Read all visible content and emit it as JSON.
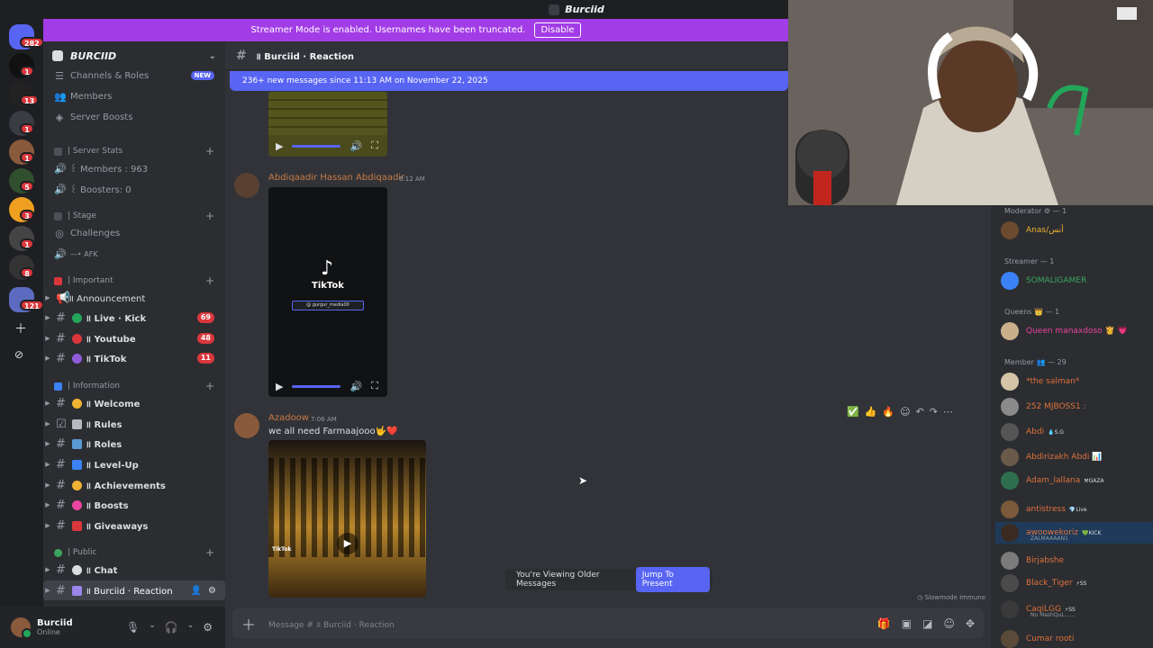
{
  "title": "Burciid",
  "streamer_banner": {
    "text": "Streamer Mode is enabled. Usernames have been truncated.",
    "button": "Disable"
  },
  "rail": {
    "badges": [
      "282",
      "1",
      "13",
      "1",
      "1",
      "5",
      "3",
      "1",
      "8",
      "1",
      "121"
    ]
  },
  "sidebar": {
    "server_name": "BURCIID",
    "top_items": [
      {
        "label": "Channels & Roles",
        "icon": "list-icon",
        "badge": "NEW"
      },
      {
        "label": "Members",
        "icon": "members-icon"
      },
      {
        "label": "Server Boosts",
        "icon": "boost-icon"
      }
    ],
    "cat_stats": "| Server Stats",
    "stat_members": "꒰ Members : 963",
    "stat_boosters": "꒰ Boosters: 0",
    "cat_stage": "| Stage",
    "challenges": "Challenges",
    "afk": "—‣ AFK",
    "cat_important": "| Important",
    "announcement": "॥ Announcement",
    "live_kick": "॥ Live · Kick",
    "live_kick_count": "69",
    "youtube": "॥ Youtube",
    "youtube_count": "48",
    "tiktok": "॥ TikTok",
    "tiktok_count": "11",
    "cat_info": "| Information",
    "welcome": "॥ Welcome",
    "rules1": "॥ Rules",
    "rules2": "॥ Roles",
    "levelup": "॥ Level-Up",
    "achievements": "॥ Achievements",
    "boosts": "॥ Boosts",
    "giveaways": "॥ Giveaways",
    "cat_public": "| Public",
    "chat": "॥ Chat",
    "reaction": "॥ Burciid · Reaction"
  },
  "user": {
    "name": "Burciid",
    "status": "Online"
  },
  "chat": {
    "channel": "॥ Burciid · Reaction",
    "new_messages": "236+ new messages since 11:13 AM on November 22, 2025",
    "msg1": {
      "author": "Abdiqaadir Hassan Abdiqaadir",
      "time": "6:12 AM",
      "tiktok_label": "TikTok",
      "tiktok_handle": "@ gurgur_media00"
    },
    "msg2": {
      "author": "Azadoow",
      "time": "7:06 AM",
      "text": "we all need Farmaajooo🤟❤️",
      "video_label": "TikTok"
    },
    "older_text": "You're Viewing Older Messages",
    "jump_button": "Jump To Present",
    "slowmode": "Slowmode Immune",
    "composer_placeholder": "Message # ॥ Burciid · Reaction"
  },
  "members": {
    "roles": [
      {
        "label": "Moderator ⚙ — 1"
      },
      {
        "label": "Streamer — 1"
      },
      {
        "label": "Queens 👑 — 1"
      },
      {
        "label": "Member 👥 — 29"
      }
    ],
    "list": [
      {
        "name": "Anas/أنس",
        "color": "#f0b232"
      },
      {
        "name": "SOMALIGAMER",
        "color": "#3ba55d"
      },
      {
        "name": "Queen manaxdoso 👸 💗",
        "color": "#eb459f"
      },
      {
        "name": "*the salman*",
        "color": "#e0713b"
      },
      {
        "name": "252 MJBOSS1 :",
        "color": "#e0713b"
      },
      {
        "name": "Abdi",
        "color": "#e0713b",
        "tag": "💧S.G"
      },
      {
        "name": "Abdirizakh Abdi 📊",
        "color": "#e0713b"
      },
      {
        "name": "Adam_lallana",
        "color": "#e0713b",
        "tag": "⚒GAZA"
      },
      {
        "name": "antistress",
        "color": "#e0713b",
        "tag": "💎Live"
      },
      {
        "name": "awoowekoriz",
        "color": "#e0713b",
        "tag": "💚KICK",
        "sub": "ZALMAAAAN1"
      },
      {
        "name": "Birjabshe",
        "color": "#e0713b"
      },
      {
        "name": "Black_Tiger",
        "color": "#e0713b",
        "tag": "⚡SS"
      },
      {
        "name": "CaqiLGG",
        "color": "#e0713b",
        "tag": "⚡SS",
        "sub": "No MashQuL......"
      },
      {
        "name": "Cumar rooti",
        "color": "#e0713b"
      }
    ]
  }
}
